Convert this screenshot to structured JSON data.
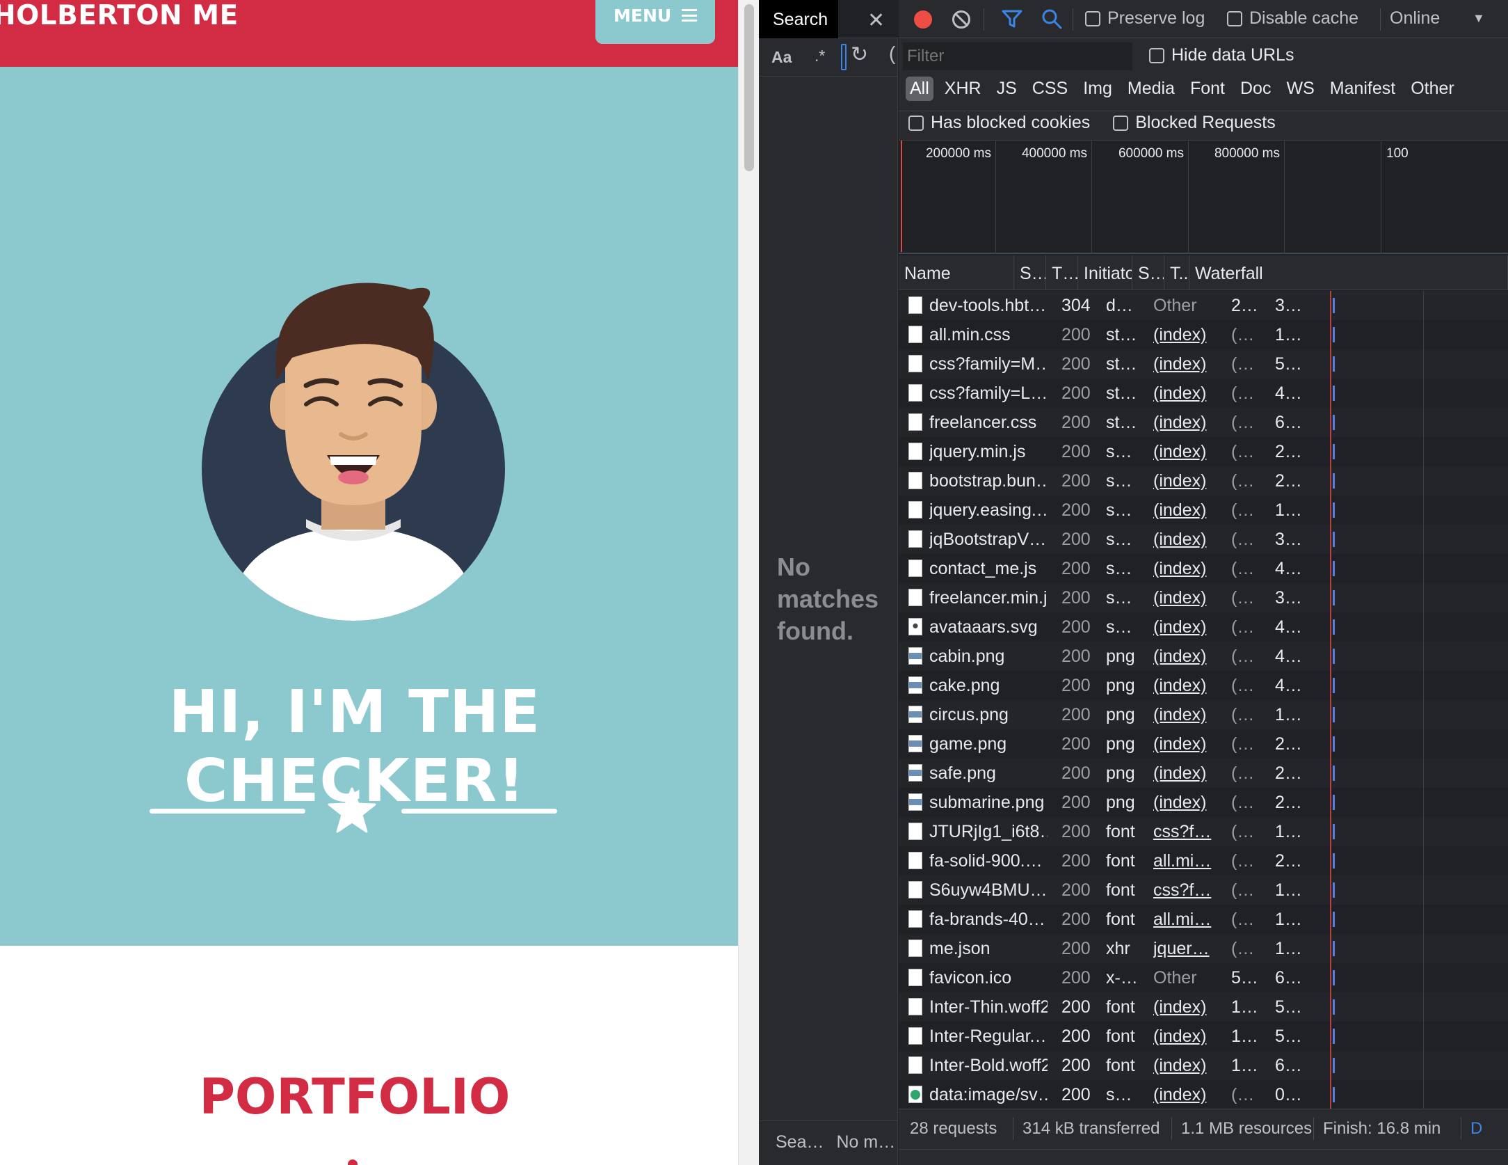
{
  "site": {
    "brand": "HOLBERTON ME",
    "menu_label": "MENU",
    "hero_title": "HI, I'M THE CHECKER!",
    "portfolio_title": "PORTFOLIO"
  },
  "search_pane": {
    "tab_label": "Search",
    "case_toggle": "Aa",
    "regex_toggle": ".*",
    "no_matches": "No matches found.",
    "status_left": "Sea…",
    "status_right": "No m…"
  },
  "network": {
    "preserve_log": "Preserve log",
    "disable_cache": "Disable cache",
    "throttling": "Online",
    "filter_placeholder": "Filter",
    "hide_data_urls": "Hide data URLs",
    "type_filters": [
      "All",
      "XHR",
      "JS",
      "CSS",
      "Img",
      "Media",
      "Font",
      "Doc",
      "WS",
      "Manifest",
      "Other"
    ],
    "has_blocked_cookies": "Has blocked cookies",
    "blocked_requests": "Blocked Requests",
    "overview_ticks": [
      "200000 ms",
      "400000 ms",
      "600000 ms",
      "800000 ms",
      "100"
    ],
    "columns": [
      "Name",
      "S…",
      "T…",
      "Initiator",
      "S…",
      "T..",
      "Waterfall"
    ],
    "requests": [
      {
        "name": "dev-tools.hbt…",
        "status": "304",
        "type": "d…",
        "initiator": "Other",
        "size": "2…",
        "time": "3…",
        "icon": "doc"
      },
      {
        "name": "all.min.css",
        "status": "200",
        "type": "st…",
        "initiator": "(index)",
        "size": "(…",
        "time": "1…",
        "icon": "doc"
      },
      {
        "name": "css?family=M…",
        "status": "200",
        "type": "st…",
        "initiator": "(index)",
        "size": "(…",
        "time": "5…",
        "icon": "doc"
      },
      {
        "name": "css?family=L…",
        "status": "200",
        "type": "st…",
        "initiator": "(index)",
        "size": "(…",
        "time": "4…",
        "icon": "doc"
      },
      {
        "name": "freelancer.css",
        "status": "200",
        "type": "st…",
        "initiator": "(index)",
        "size": "(…",
        "time": "6…",
        "icon": "doc"
      },
      {
        "name": "jquery.min.js",
        "status": "200",
        "type": "s…",
        "initiator": "(index)",
        "size": "(…",
        "time": "2…",
        "icon": "doc"
      },
      {
        "name": "bootstrap.bun…",
        "status": "200",
        "type": "s…",
        "initiator": "(index)",
        "size": "(…",
        "time": "2…",
        "icon": "doc"
      },
      {
        "name": "jquery.easing.…",
        "status": "200",
        "type": "s…",
        "initiator": "(index)",
        "size": "(…",
        "time": "1…",
        "icon": "doc"
      },
      {
        "name": "jqBootstrapV…",
        "status": "200",
        "type": "s…",
        "initiator": "(index)",
        "size": "(…",
        "time": "3…",
        "icon": "doc"
      },
      {
        "name": "contact_me.js",
        "status": "200",
        "type": "s…",
        "initiator": "(index)",
        "size": "(…",
        "time": "4…",
        "icon": "doc"
      },
      {
        "name": "freelancer.min.js",
        "status": "200",
        "type": "s…",
        "initiator": "(index)",
        "size": "(…",
        "time": "3…",
        "icon": "doc"
      },
      {
        "name": "avataaars.svg",
        "status": "200",
        "type": "s…",
        "initiator": "(index)",
        "size": "(…",
        "time": "4…",
        "icon": "svg"
      },
      {
        "name": "cabin.png",
        "status": "200",
        "type": "png",
        "initiator": "(index)",
        "size": "(…",
        "time": "4…",
        "icon": "img"
      },
      {
        "name": "cake.png",
        "status": "200",
        "type": "png",
        "initiator": "(index)",
        "size": "(…",
        "time": "4…",
        "icon": "img"
      },
      {
        "name": "circus.png",
        "status": "200",
        "type": "png",
        "initiator": "(index)",
        "size": "(…",
        "time": "1…",
        "icon": "img"
      },
      {
        "name": "game.png",
        "status": "200",
        "type": "png",
        "initiator": "(index)",
        "size": "(…",
        "time": "2…",
        "icon": "img"
      },
      {
        "name": "safe.png",
        "status": "200",
        "type": "png",
        "initiator": "(index)",
        "size": "(…",
        "time": "2…",
        "icon": "img"
      },
      {
        "name": "submarine.png",
        "status": "200",
        "type": "png",
        "initiator": "(index)",
        "size": "(…",
        "time": "2…",
        "icon": "img"
      },
      {
        "name": "JTURjIg1_i6t8…",
        "status": "200",
        "type": "font",
        "initiator": "css?f…",
        "size": "(…",
        "time": "1…",
        "icon": "font"
      },
      {
        "name": "fa-solid-900.…",
        "status": "200",
        "type": "font",
        "initiator": "all.mi…",
        "size": "(…",
        "time": "2…",
        "icon": "font"
      },
      {
        "name": "S6uyw4BMU…",
        "status": "200",
        "type": "font",
        "initiator": "css?f…",
        "size": "(…",
        "time": "1…",
        "icon": "font"
      },
      {
        "name": "fa-brands-40…",
        "status": "200",
        "type": "font",
        "initiator": "all.mi…",
        "size": "(…",
        "time": "1…",
        "icon": "font"
      },
      {
        "name": "me.json",
        "status": "200",
        "type": "xhr",
        "initiator": "jquer…",
        "size": "(…",
        "time": "1…",
        "icon": "font"
      },
      {
        "name": "favicon.ico",
        "status": "200",
        "type": "x-…",
        "initiator": "Other",
        "size": "5…",
        "time": "6…",
        "icon": "font"
      },
      {
        "name": "Inter-Thin.woff2",
        "status": "200",
        "type": "font",
        "initiator": "(index)",
        "size": "1…",
        "time": "5…",
        "icon": "font"
      },
      {
        "name": "Inter-Regular.…",
        "status": "200",
        "type": "font",
        "initiator": "(index)",
        "size": "1…",
        "time": "5…",
        "icon": "font"
      },
      {
        "name": "Inter-Bold.woff2",
        "status": "200",
        "type": "font",
        "initiator": "(index)",
        "size": "1…",
        "time": "6…",
        "icon": "font"
      },
      {
        "name": "data:image/sv…",
        "status": "200",
        "type": "s…",
        "initiator": "(index)",
        "size": "(…",
        "time": "0…",
        "icon": "data"
      }
    ],
    "summary": {
      "requests": "28 requests",
      "transferred": "314 kB transferred",
      "resources": "1.1 MB resources",
      "finish": "Finish: 16.8 min",
      "more": "D"
    }
  },
  "colors": {
    "brand_red": "#d22c45",
    "teal": "#8bc9cf",
    "devtools_bg": "#202124",
    "record_red": "#ed4d43",
    "filter_blue": "#3a86e6"
  }
}
